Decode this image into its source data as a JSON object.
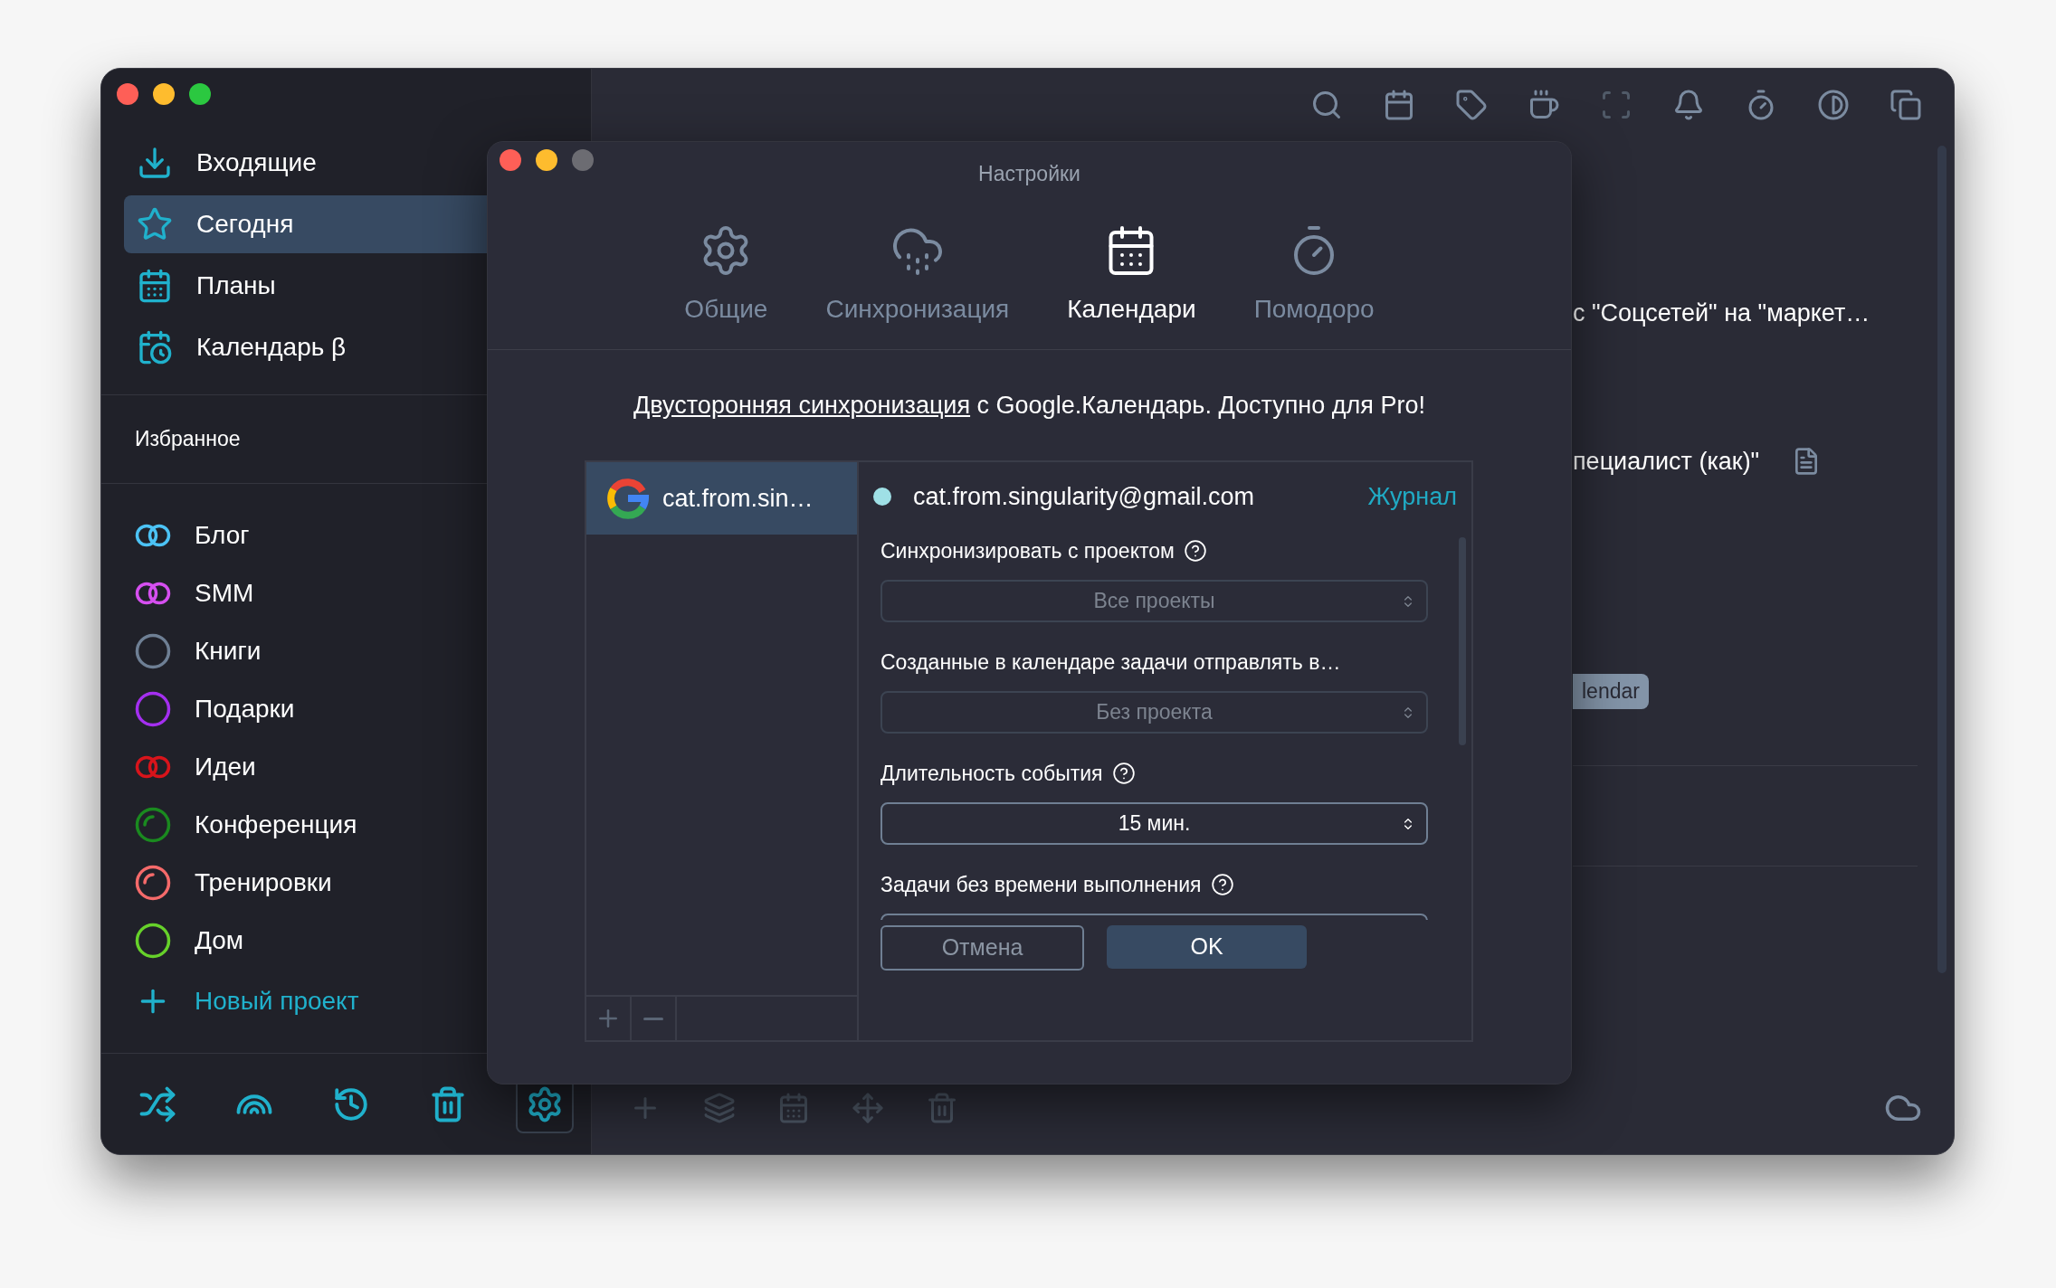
{
  "sidebar": {
    "nav": [
      {
        "kind": "inbox",
        "label": "Входящие",
        "selected": false
      },
      {
        "kind": "today",
        "label": "Сегодня",
        "selected": true
      },
      {
        "kind": "plans",
        "label": "Планы",
        "selected": false
      },
      {
        "kind": "calendar",
        "label": "Календарь β",
        "selected": false
      }
    ],
    "favorites_heading": "Избранное",
    "projects": [
      {
        "label": "Блог",
        "color": "#4cc3f5",
        "kind": "double"
      },
      {
        "label": "SMM",
        "color": "#d64ff0",
        "kind": "double"
      },
      {
        "label": "Книги",
        "color": "#6e7f94",
        "kind": "ring"
      },
      {
        "label": "Подарки",
        "color": "#a42ff0",
        "kind": "ring"
      },
      {
        "label": "Идеи",
        "color": "#d8141b",
        "kind": "double"
      },
      {
        "label": "Конференция",
        "color": "#1a8a1f",
        "kind": "progress"
      },
      {
        "label": "Тренировки",
        "color": "#f56a6a",
        "kind": "progress"
      },
      {
        "label": "Дом",
        "color": "#66d12a",
        "kind": "ring"
      }
    ],
    "new_project": "Новый проект",
    "footer_buttons": [
      {
        "kind": "shuffle",
        "selected": false
      },
      {
        "kind": "rainbow",
        "selected": false
      },
      {
        "kind": "history",
        "selected": false
      },
      {
        "kind": "trash",
        "selected": false
      },
      {
        "kind": "settings",
        "selected": true
      }
    ]
  },
  "main": {
    "tasks": [
      {
        "text": "с \"Соцсетей\" на \"маркет…",
        "note": false
      },
      {
        "text": "пециалист (как)\"",
        "note": true
      }
    ],
    "tag": "lendar"
  },
  "dialog": {
    "title": "Настройки",
    "tabs": [
      {
        "kind": "general",
        "label": "Общие",
        "selected": false
      },
      {
        "kind": "sync",
        "label": "Синхронизация",
        "selected": false
      },
      {
        "kind": "calendars",
        "label": "Календари",
        "selected": true
      },
      {
        "kind": "pomodoro",
        "label": "Помодоро",
        "selected": false
      }
    ],
    "notice": {
      "link": "Двусторонняя синхронизация",
      "text": " с Google.Календарь. Доступно для Pro!"
    },
    "accounts": [
      {
        "label": "cat.from.sin…",
        "selected": true,
        "color": "#9fe0e6"
      }
    ],
    "account": {
      "email": "cat.from.singularity@gmail.com",
      "log_link": "Журнал"
    },
    "fields": [
      {
        "label": "Синхронизировать с проектом",
        "help": true,
        "value": "Все проекты",
        "disabled": true
      },
      {
        "label": "Созданные в календаре задачи отправлять в…",
        "help": false,
        "value": "Без проекта",
        "disabled": true
      },
      {
        "label": "Длительность события",
        "help": true,
        "value": "15 мин.",
        "disabled": false
      },
      {
        "label": "Задачи без времени выполнения",
        "help": true
      }
    ],
    "cancel": "Отмена",
    "ok": "OK"
  }
}
